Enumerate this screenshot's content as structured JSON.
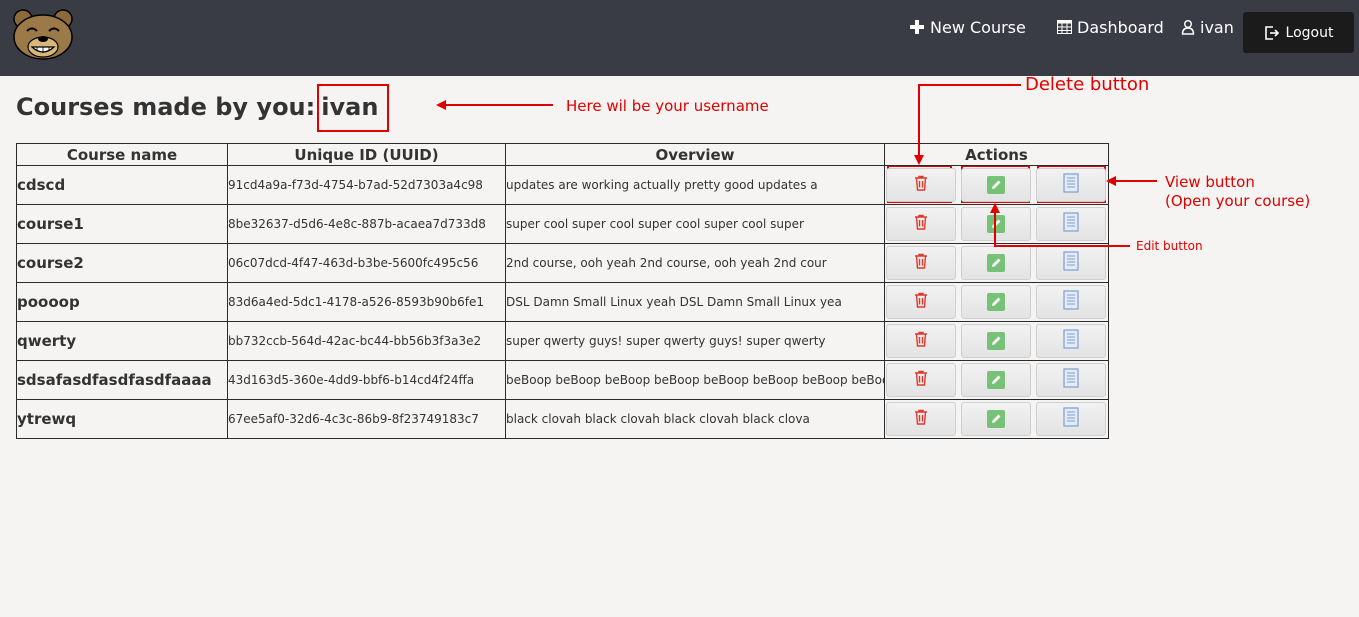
{
  "navbar": {
    "new_course_label": "New Course",
    "dashboard_label": "Dashboard",
    "user_label": "ivan",
    "logout_label": "Logout"
  },
  "page": {
    "title_prefix": "Courses made by you:",
    "username": "ivan"
  },
  "table": {
    "headers": [
      "Course name",
      "Unique ID (UUID)",
      "Overview",
      "Actions"
    ],
    "rows": [
      {
        "name": "cdscd",
        "uuid": "91cd4a9a-f73d-4754-b7ad-52d7303a4c98",
        "overview": "updates are working actually pretty good updates a"
      },
      {
        "name": "course1",
        "uuid": "8be32637-d5d6-4e8c-887b-acaea7d733d8",
        "overview": "super cool super cool super cool super cool super"
      },
      {
        "name": "course2",
        "uuid": "06c07dcd-4f47-463d-b3be-5600fc495c56",
        "overview": "2nd course, ooh yeah 2nd course, ooh yeah 2nd cour"
      },
      {
        "name": "poooop",
        "uuid": "83d6a4ed-5dc1-4178-a526-8593b90b6fe1",
        "overview": "DSL Damn Small Linux yeah DSL Damn Small Linux yea"
      },
      {
        "name": "qwerty",
        "uuid": "bb732ccb-564d-42ac-bc44-bb56b3f3a3e2",
        "overview": "super qwerty guys! super qwerty guys! super qwerty"
      },
      {
        "name": "sdsafasdfasdfasdfaaaa",
        "uuid": "43d163d5-360e-4dd9-bbf6-b14cd4f24ffa",
        "overview": "beBoop beBoop beBoop beBoop beBoop beBoop beBoop beBoop"
      },
      {
        "name": "ytrewq",
        "uuid": "67ee5af0-32d6-4c3c-86b9-8f23749183c7",
        "overview": "black clovah black clovah black clovah black clova"
      }
    ]
  },
  "annotations": {
    "username_note": "Here wil be your username",
    "delete_note": "Delete button",
    "view_note_line1": "View button",
    "view_note_line2": "(Open your course)",
    "edit_note": "Edit button",
    "color": "#e00000"
  },
  "icons": {
    "logo": "bear-logo",
    "new_course": "plus-icon",
    "dashboard": "table-icon",
    "user": "user-icon",
    "logout": "logout-icon",
    "delete": "trash-icon",
    "edit": "pencil-icon",
    "view": "document-icon"
  },
  "colors": {
    "navbar": "#3a3c45",
    "delete": "#e0392b",
    "edit": "#5cb85c",
    "view": "#7a9fd6"
  }
}
